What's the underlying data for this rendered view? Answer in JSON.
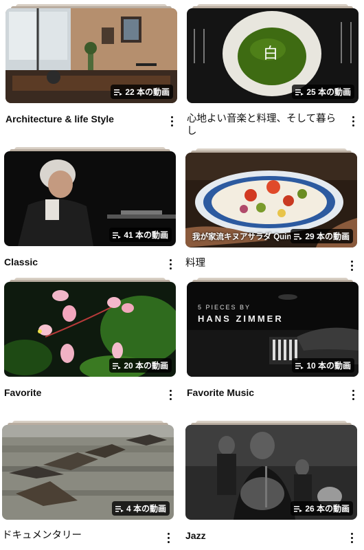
{
  "playlists": [
    {
      "title": "Architecture & life Style",
      "count": "22 本の動画"
    },
    {
      "title": "心地よい音楽と料理、そして暮らし",
      "count": "25 本の動画",
      "thumb_text": "白"
    },
    {
      "title": "Classic",
      "count": "41 本の動画"
    },
    {
      "title": "料理",
      "count": "29 本の動画",
      "thumb_text": "我が家流キヌアサラダ Quin"
    },
    {
      "title": "Favorite",
      "count": "20 本の動画"
    },
    {
      "title": "Favorite Music",
      "count": "10 本の動画",
      "thumb_text_small": "5 PIECES BY",
      "thumb_text_big": "HANS ZIMMER"
    },
    {
      "title": "ドキュメンタリー",
      "count": "4 本の動画"
    },
    {
      "title": "Jazz",
      "count": "26 本の動画"
    }
  ],
  "icons": {
    "playlist": "playlist-icon",
    "more": "more-vert-icon"
  }
}
